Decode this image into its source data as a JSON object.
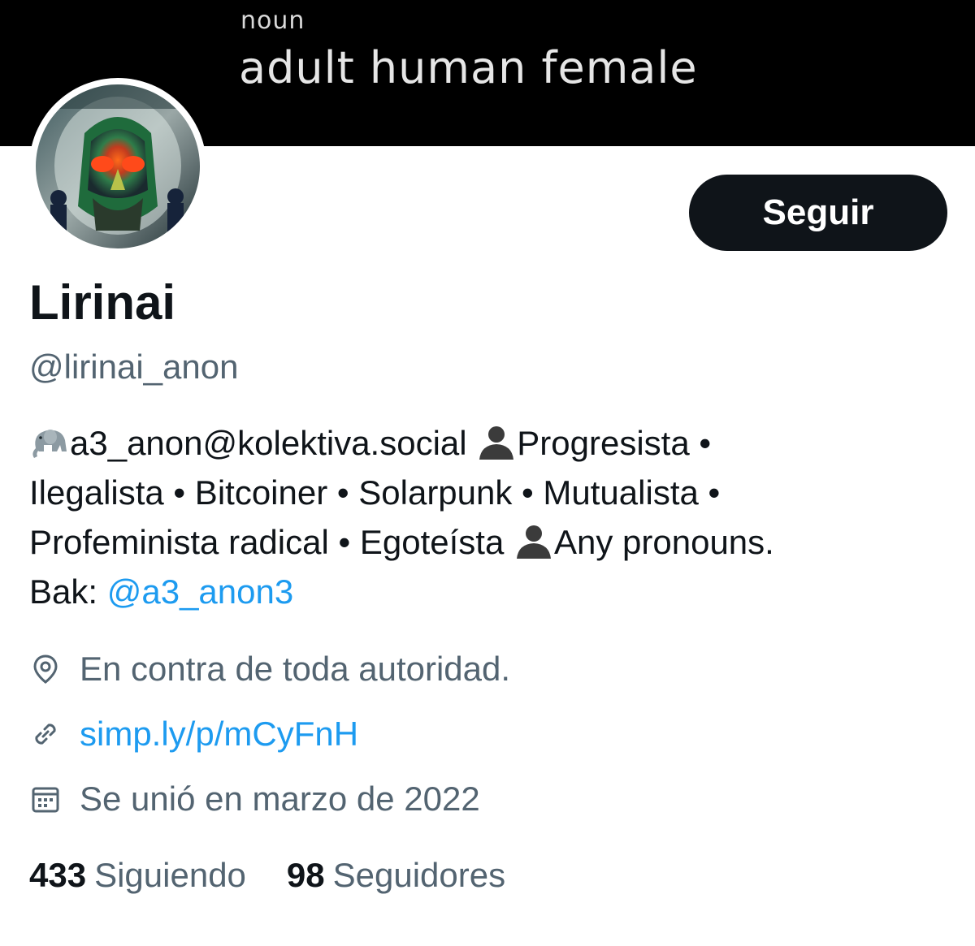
{
  "banner": {
    "part_of_speech": "noun",
    "definition": "adult human female"
  },
  "profile": {
    "follow_label": "Seguir",
    "display_name": "Lirinai",
    "handle": "@lirinai_anon"
  },
  "bio": {
    "line1_text1": "a3_anon@kolektiva.social ",
    "line1_text2": "Progresista •",
    "line2": "Ilegalista • Bitcoiner • Solarpunk • Mutualista •",
    "line3_text1": "Profeminista radical • Egoteísta ",
    "line3_text2": "Any pronouns.",
    "line4_prefix": "Bak: ",
    "line4_link": "@a3_anon3",
    "icons": [
      "elephant-emoji",
      "bust-silhouette-emoji"
    ]
  },
  "meta": {
    "location": "En contra de toda autoridad.",
    "website": "simp.ly/p/mCyFnH",
    "joined": "Se unió en marzo de 2022"
  },
  "stats": {
    "following_count": "433",
    "following_label": "Siguiendo",
    "followers_count": "98",
    "followers_label": "Seguidores"
  },
  "colors": {
    "link": "#1d9bf0",
    "secondary_text": "#536471",
    "primary_text": "#0f1419",
    "button_bg": "#0f1419"
  }
}
